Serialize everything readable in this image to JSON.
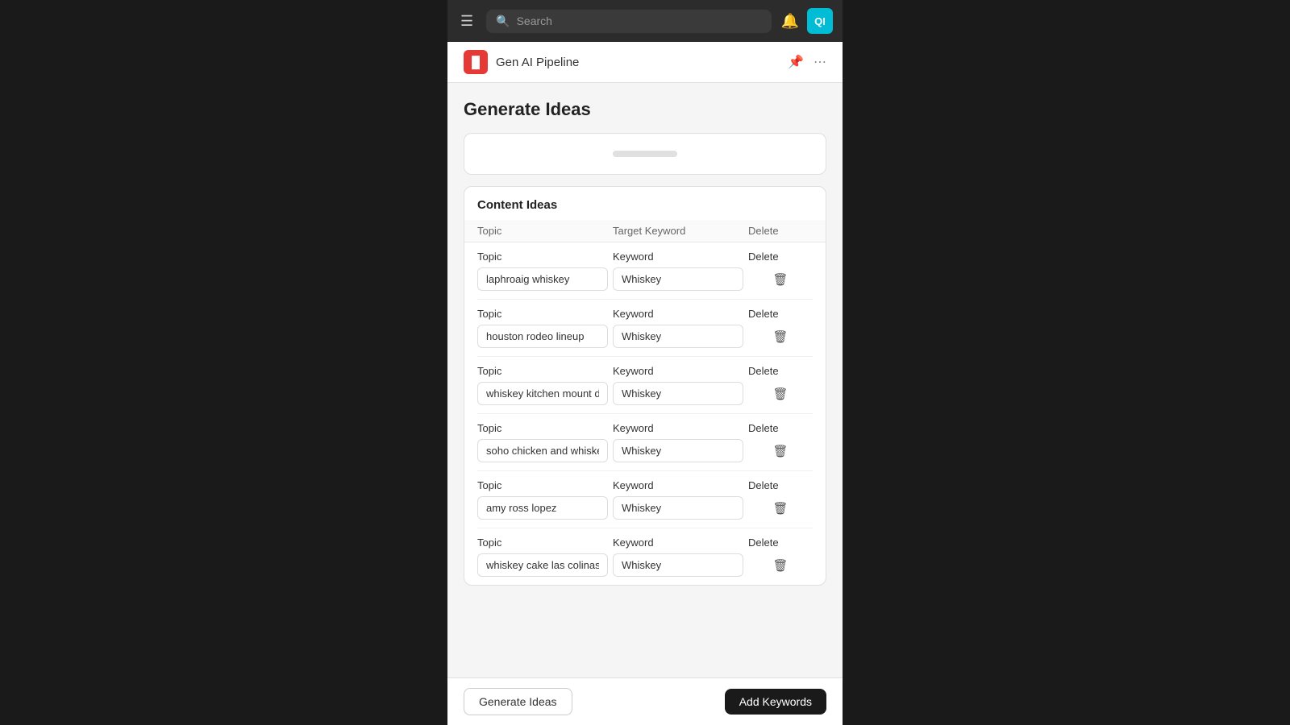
{
  "nav": {
    "search_placeholder": "Search",
    "avatar_text": "QI",
    "hamburger_icon": "☰",
    "bell_icon": "🔔",
    "search_icon": "🔍"
  },
  "page_header": {
    "app_icon_text": "▐▌",
    "title": "Gen AI Pipeline",
    "pin_icon": "📌",
    "more_icon": "⋯"
  },
  "main": {
    "title": "Generate Ideas",
    "content_ideas_heading": "Content Ideas",
    "table_headers": {
      "topic": "Topic",
      "target_keyword": "Target Keyword",
      "delete": "Delete"
    },
    "rows": [
      {
        "id": 1,
        "topic_label": "Topic",
        "topic_value": "laphroaig whiskey",
        "keyword_label": "Keyword",
        "keyword_value": "Whiskey",
        "delete_label": "Delete"
      },
      {
        "id": 2,
        "topic_label": "Topic",
        "topic_value": "houston rodeo lineup",
        "keyword_label": "Keyword",
        "keyword_value": "Whiskey",
        "delete_label": "Delete"
      },
      {
        "id": 3,
        "topic_label": "Topic",
        "topic_value": "whiskey kitchen mount dora",
        "keyword_label": "Keyword",
        "keyword_value": "Whiskey",
        "delete_label": "Delete"
      },
      {
        "id": 4,
        "topic_label": "Topic",
        "topic_value": "soho chicken and whiskey",
        "keyword_label": "Keyword",
        "keyword_value": "Whiskey",
        "delete_label": "Delete"
      },
      {
        "id": 5,
        "topic_label": "Topic",
        "topic_value": "amy ross lopez",
        "keyword_label": "Keyword",
        "keyword_value": "Whiskey",
        "delete_label": "Delete"
      },
      {
        "id": 6,
        "topic_label": "Topic",
        "topic_value": "whiskey cake las colinas",
        "keyword_label": "Keyword",
        "keyword_value": "Whiskey",
        "delete_label": "Delete"
      }
    ]
  },
  "bottom_bar": {
    "generate_label": "Generate Ideas",
    "add_keywords_label": "Add Keywords"
  }
}
